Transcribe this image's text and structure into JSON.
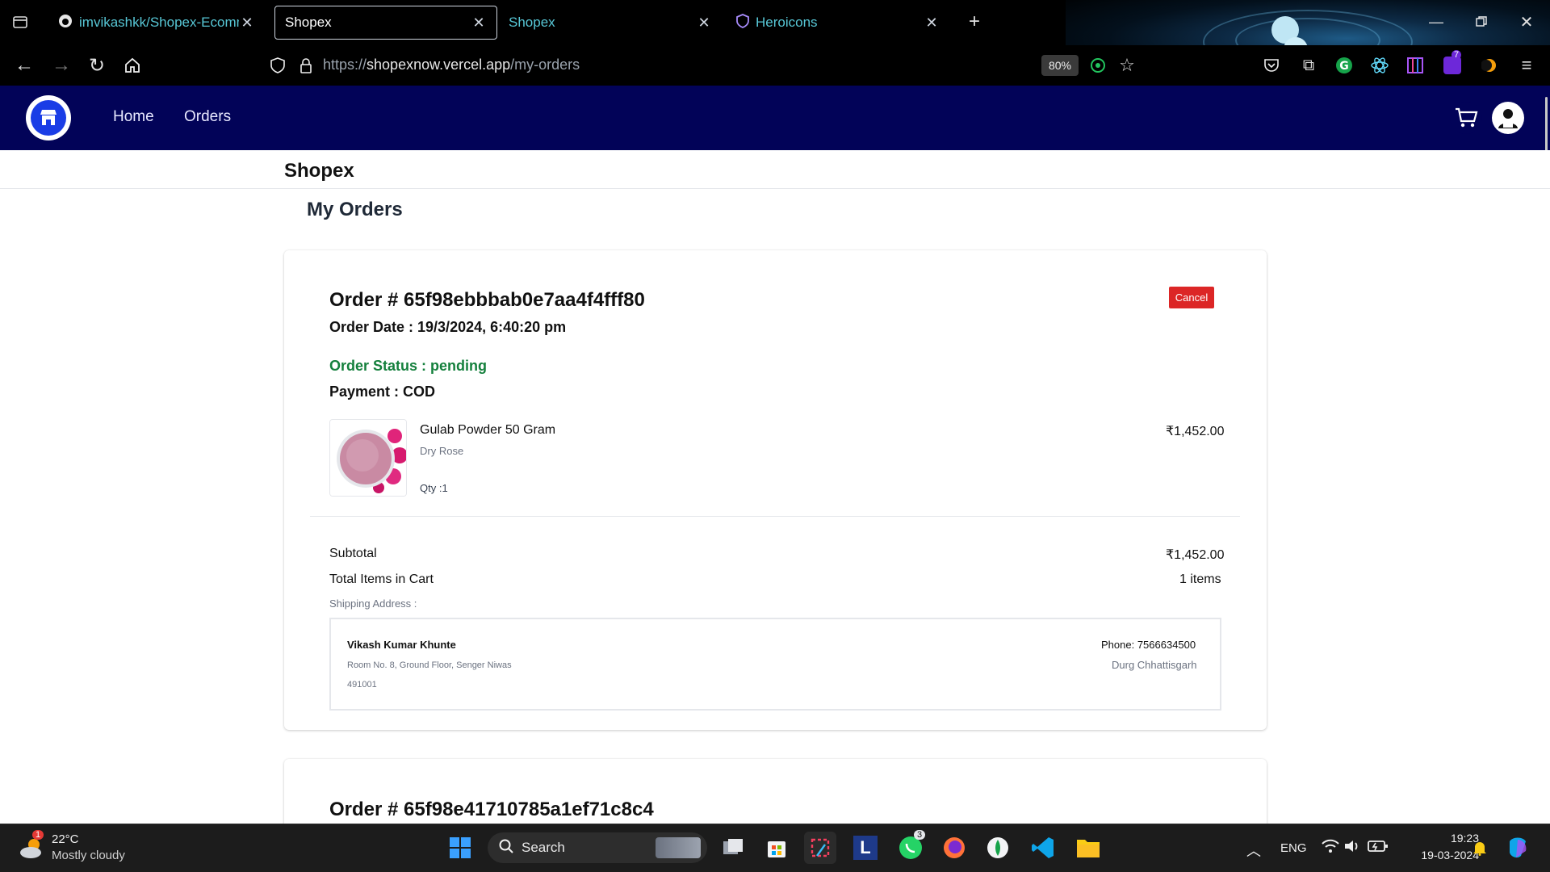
{
  "browser": {
    "tabs": [
      {
        "title": "imvikashkk/Shopex-Ecommerce",
        "icon": "github-icon"
      },
      {
        "title": "Shopex",
        "icon": "none"
      },
      {
        "title": "Shopex",
        "icon": "none"
      },
      {
        "title": "Heroicons",
        "icon": "heroicons-shield-icon"
      }
    ],
    "new_tab": "+",
    "url_prefix": "https://",
    "url_host": "shopexnow.vercel.app",
    "url_path": "/my-orders",
    "zoom": "80%",
    "extension_badge": "7"
  },
  "app": {
    "nav": {
      "home": "Home",
      "orders": "Orders"
    },
    "brand": "Shopex",
    "page_title": "My Orders",
    "accent_color": "#020358"
  },
  "orders": [
    {
      "id_label": "Order # 65f98ebbbab0e7aa4f4fff80",
      "date_label": "Order Date : 19/3/2024, 6:40:20 pm",
      "status_label": "Order Status : pending",
      "payment_label": "Payment : COD",
      "cancel_label": "Cancel",
      "item": {
        "name": "Gulab Powder 50 Gram",
        "brand": "Dry Rose",
        "qty": "Qty :1",
        "price": "₹1,452.00"
      },
      "subtotal_label": "Subtotal",
      "subtotal_value": "₹1,452.00",
      "items_label": "Total Items in Cart",
      "items_value": "1 items",
      "shipping_heading": "Shipping Address :",
      "address": {
        "name": "Vikash Kumar Khunte",
        "street": "Room No. 8, Ground Floor, Senger Niwas",
        "pin": "491001",
        "phone": "Phone: 7566634500",
        "city": "Durg Chhattisgarh"
      }
    },
    {
      "id_label": "Order # 65f98e41710785a1ef71c8c4"
    }
  ],
  "taskbar": {
    "weather_temp": "22°C",
    "weather_desc": "Mostly cloudy",
    "weather_badge": "1",
    "search": "Search",
    "whatsapp_badge": "3",
    "lang": "ENG",
    "time": "19:23",
    "date": "19-03-2024"
  }
}
